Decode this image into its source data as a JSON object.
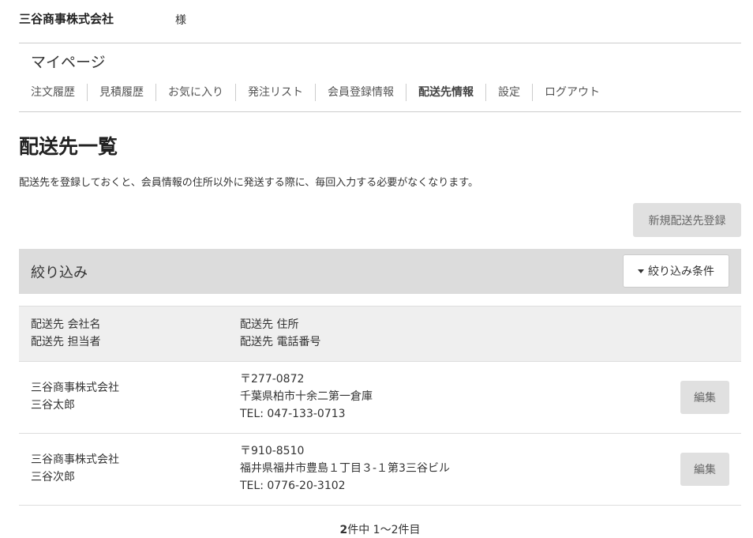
{
  "header": {
    "company": "三谷商事株式会社",
    "honorific": "様"
  },
  "mypage": {
    "title": "マイページ"
  },
  "nav": {
    "items": [
      {
        "label": "注文履歴"
      },
      {
        "label": "見積履歴"
      },
      {
        "label": "お気に入り"
      },
      {
        "label": "発注リスト"
      },
      {
        "label": "会員登録情報"
      },
      {
        "label": "配送先情報",
        "active": true
      },
      {
        "label": "設定"
      },
      {
        "label": "ログアウト"
      }
    ]
  },
  "page": {
    "title": "配送先一覧",
    "description": "配送先を登録しておくと、会員情報の住所以外に発送する際に、毎回入力する必要がなくなります。",
    "new_button": "新規配送先登録"
  },
  "filter": {
    "label": "絞り込み",
    "button": "絞り込み条件",
    "button_icon": "caret-down-icon"
  },
  "table": {
    "headers": {
      "col1_line1": "配送先 会社名",
      "col1_line2": "配送先 担当者",
      "col2_line1": "配送先 住所",
      "col2_line2": "配送先 電話番号"
    },
    "rows": [
      {
        "company": "三谷商事株式会社",
        "person": "三谷太郎",
        "postal": "〒277-0872",
        "address": "千葉県柏市十余二第一倉庫",
        "tel": "TEL: 047-133-0713",
        "edit": "編集"
      },
      {
        "company": "三谷商事株式会社",
        "person": "三谷次郎",
        "postal": "〒910-8510",
        "address": "福井県福井市豊島１丁目３-１第3三谷ビル",
        "tel": "TEL: 0776-20-3102",
        "edit": "編集"
      }
    ]
  },
  "pager": {
    "count": "2",
    "text": "件中 1～2件目"
  }
}
